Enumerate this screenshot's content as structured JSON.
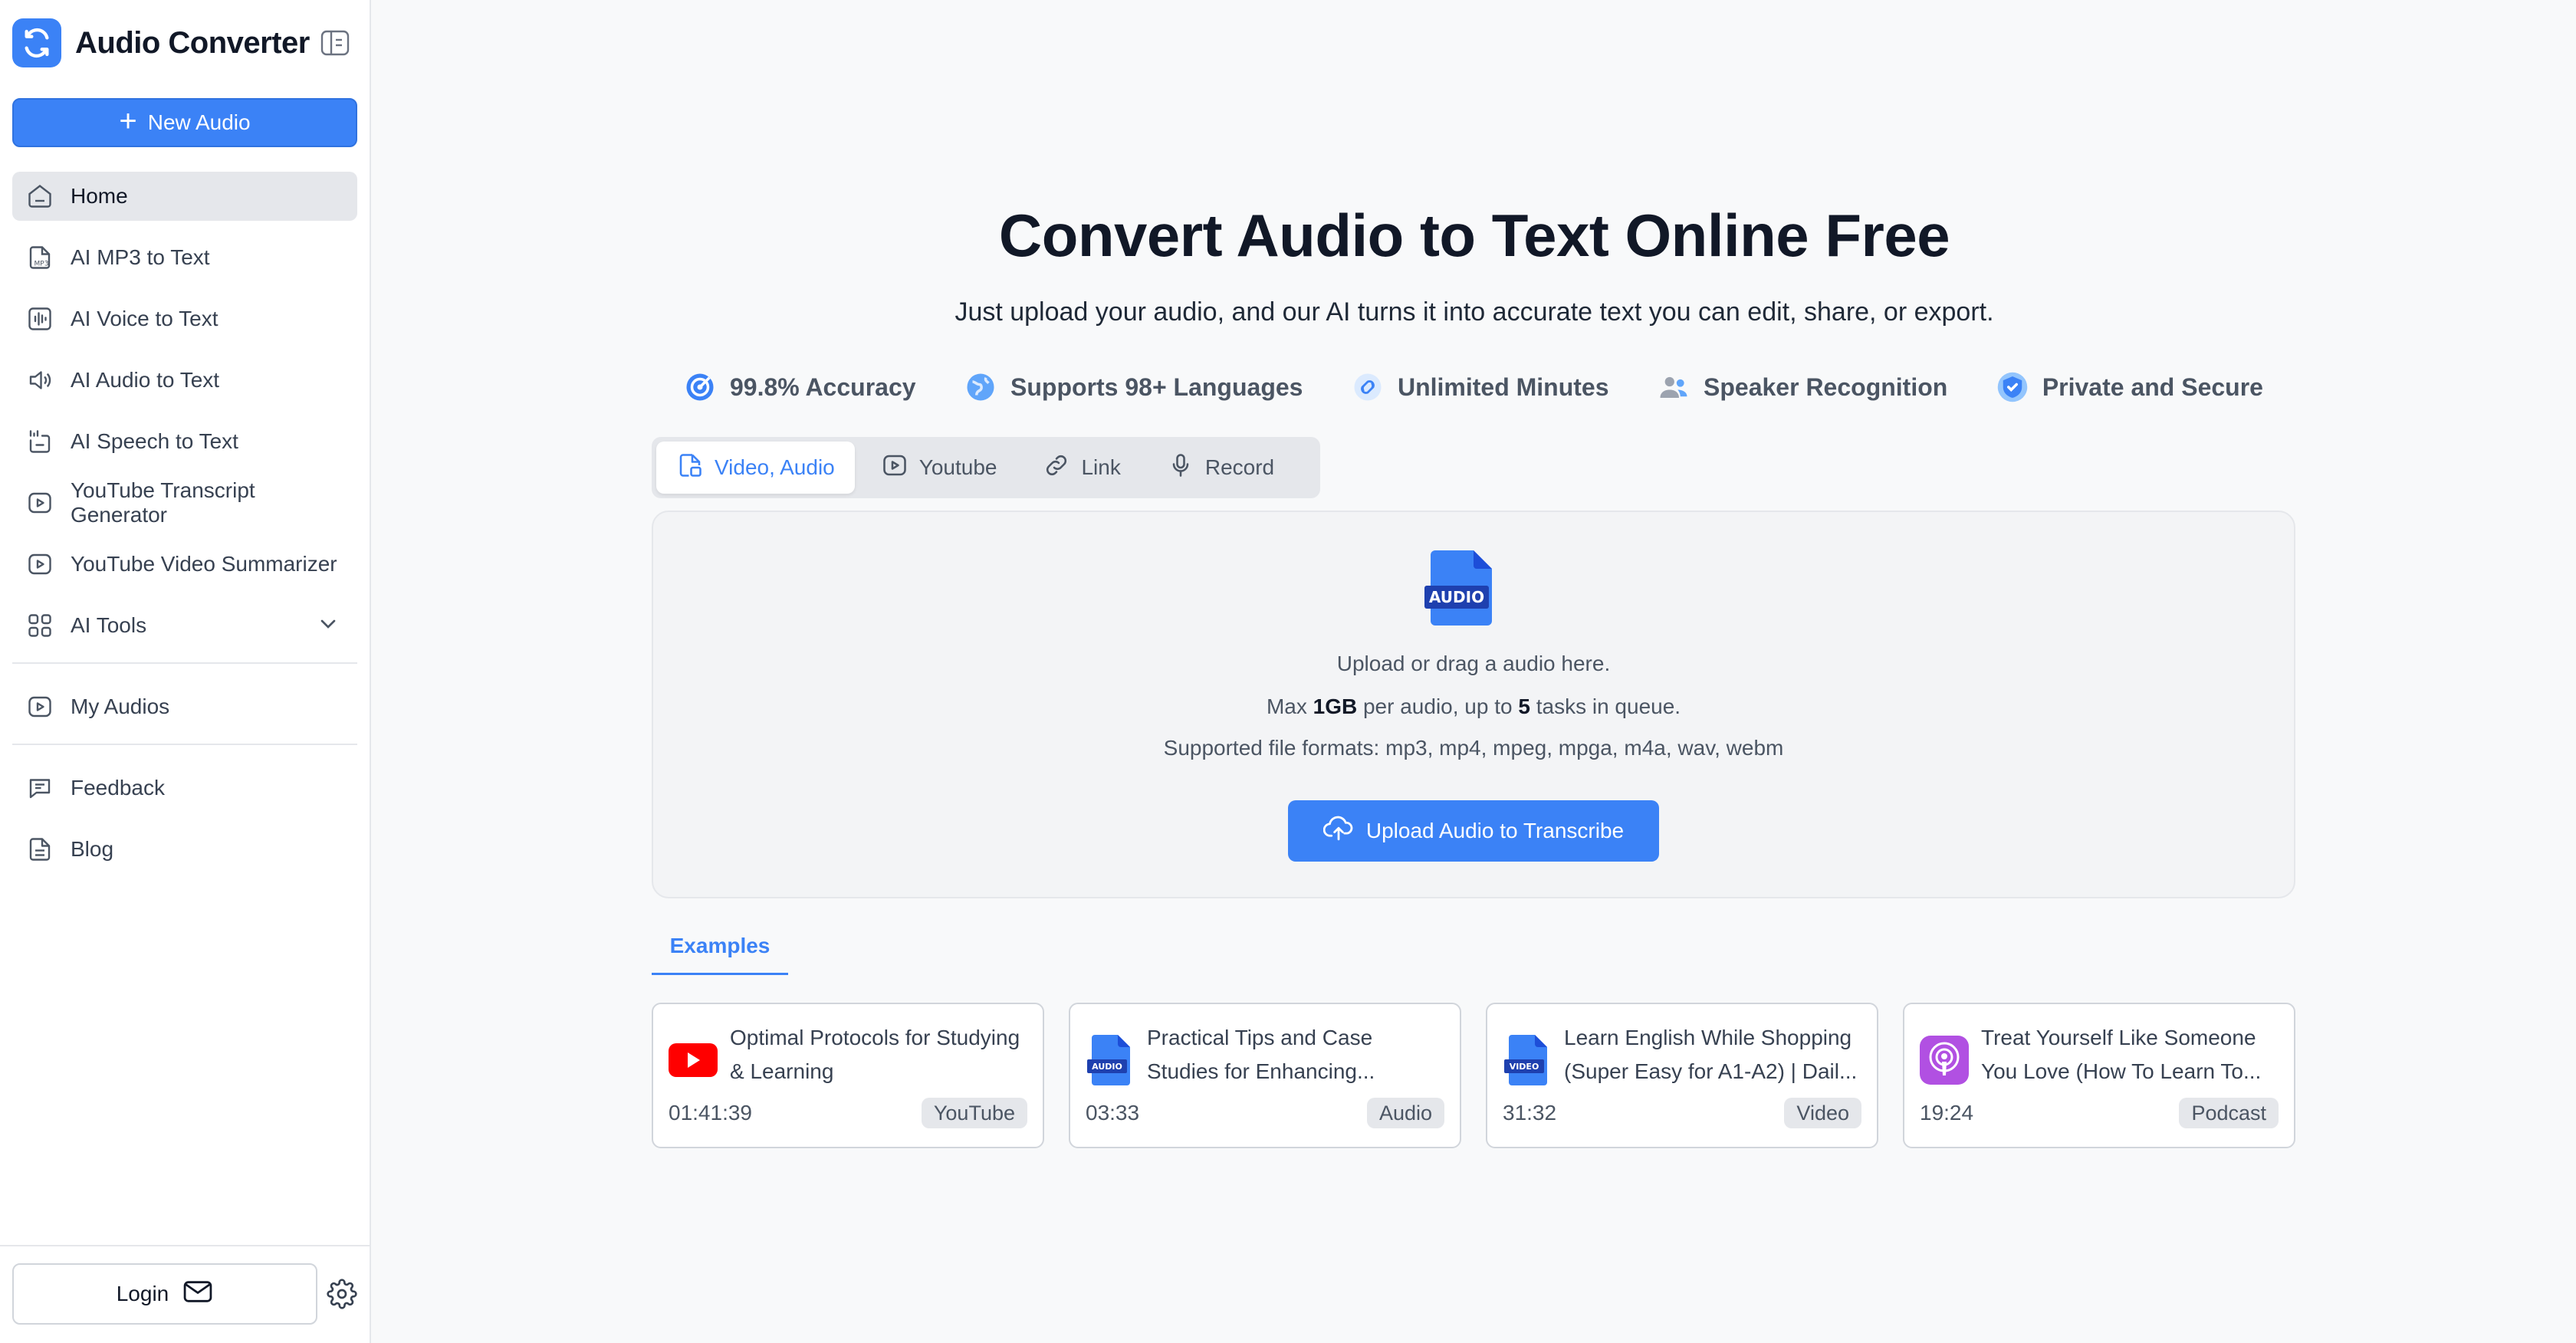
{
  "app": {
    "title": "Audio Converter"
  },
  "sidebar": {
    "new_button": "New Audio",
    "items": [
      {
        "label": "Home",
        "icon": "home-icon"
      },
      {
        "label": "AI MP3 to Text",
        "icon": "mp3-file-icon"
      },
      {
        "label": "AI Voice to Text",
        "icon": "voice-wave-icon"
      },
      {
        "label": "AI Audio to Text",
        "icon": "speaker-icon"
      },
      {
        "label": "AI Speech to Text",
        "icon": "speech-icon"
      },
      {
        "label": "YouTube Transcript Generator",
        "icon": "play-box-icon"
      },
      {
        "label": "YouTube Video Summarizer",
        "icon": "play-box-icon"
      },
      {
        "label": "AI Tools",
        "icon": "grid-icon"
      },
      {
        "label": "My Audios",
        "icon": "play-box-icon"
      },
      {
        "label": "Feedback",
        "icon": "feedback-icon"
      },
      {
        "label": "Blog",
        "icon": "document-icon"
      }
    ],
    "login_label": "Login"
  },
  "hero": {
    "title": "Convert Audio to Text Online Free",
    "subtitle": "Just upload your audio, and our AI turns it into accurate text you can edit, share, or export."
  },
  "features": [
    {
      "label": "99.8% Accuracy",
      "icon": "target-icon"
    },
    {
      "label": "Supports 98+ Languages",
      "icon": "globe-icon"
    },
    {
      "label": "Unlimited Minutes",
      "icon": "infinity-icon"
    },
    {
      "label": "Speaker Recognition",
      "icon": "users-icon"
    },
    {
      "label": "Private and Secure",
      "icon": "shield-icon"
    }
  ],
  "tabs": [
    {
      "label": "Video, Audio"
    },
    {
      "label": "Youtube"
    },
    {
      "label": "Link"
    },
    {
      "label": "Record"
    }
  ],
  "dropzone": {
    "file_icon_text": "AUDIO",
    "line1": "Upload or drag a audio here.",
    "line2_prefix": "Max ",
    "line2_size": "1GB",
    "line2_mid": " per audio, up to ",
    "line2_count": "5",
    "line2_suffix": " tasks in queue.",
    "line3": "Supported file formats: mp3, mp4, mpeg, mpga, m4a, wav, webm",
    "upload_button": "Upload Audio to Transcribe"
  },
  "examples": {
    "tab_label": "Examples",
    "cards": [
      {
        "title": "Optimal Protocols for Studying & Learning",
        "duration": "01:41:39",
        "badge": "YouTube",
        "thumb": "youtube-icon"
      },
      {
        "title": "Practical Tips and Case Studies for Enhancing...",
        "duration": "03:33",
        "badge": "Audio",
        "thumb": "audio-file-icon"
      },
      {
        "title": "Learn English While Shopping (Super Easy for A1-A2) | Dail...",
        "duration": "31:32",
        "badge": "Video",
        "thumb": "video-file-icon"
      },
      {
        "title": "Treat Yourself Like Someone You Love (How To Learn To...",
        "duration": "19:24",
        "badge": "Podcast",
        "thumb": "podcast-icon"
      }
    ]
  },
  "colors": {
    "accent": "#3b82f6",
    "youtube": "#ff0000",
    "podcast": "#b150e2"
  }
}
